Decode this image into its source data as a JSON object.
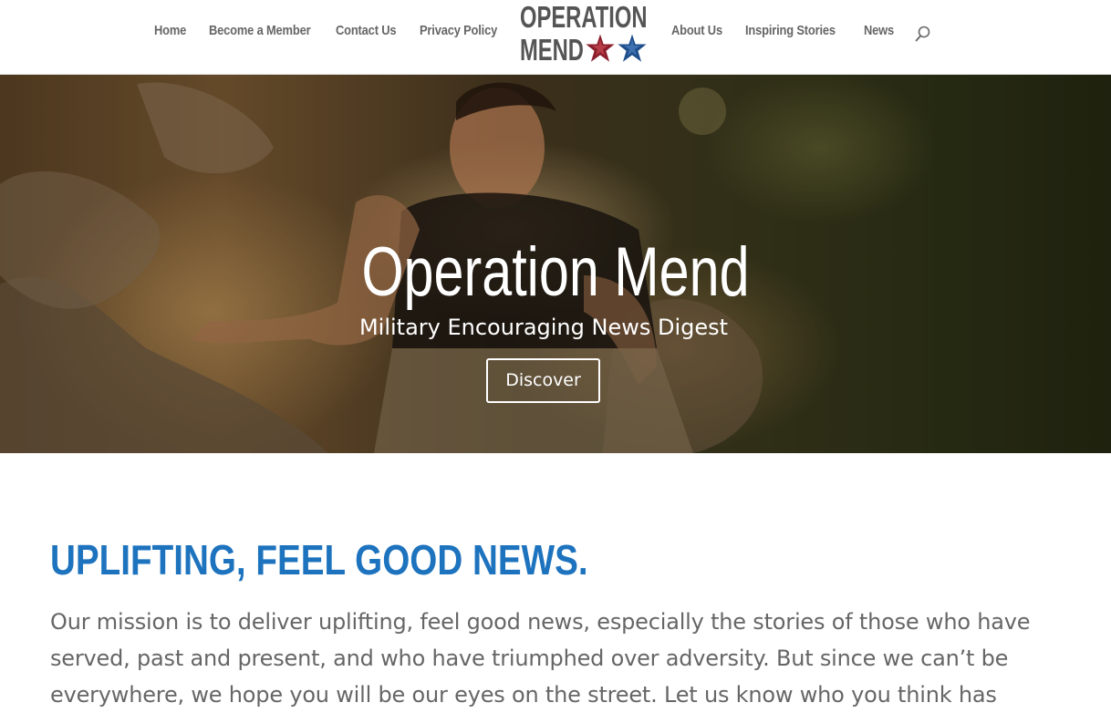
{
  "nav": {
    "left": [
      "Home",
      "Become a Member",
      "Contact Us",
      "Privacy Policy"
    ],
    "right": [
      "About Us",
      "Inspiring Stories",
      "News"
    ]
  },
  "logo": {
    "line1": "OPERATION",
    "line2": "MEND",
    "star_colors": [
      "#8b1e2b",
      "#1f4e8c"
    ]
  },
  "search": {
    "icon": "search-icon"
  },
  "hero": {
    "title": "Operation Mend",
    "subtitle": "Military Encouraging News Digest",
    "button_label": "Discover"
  },
  "content": {
    "headline": "UPLIFTING, FEEL GOOD NEWS.",
    "paragraph": "Our mission is to deliver uplifting, feel good news, especially the stories of those who have served, past and present, and who have triumphed over adversity. But since we can’t be everywhere, we hope you will be our eyes on the street. Let us know who you think has"
  },
  "colors": {
    "headline": "#1e73be",
    "nav_text": "#666666",
    "body_text": "#666666"
  }
}
